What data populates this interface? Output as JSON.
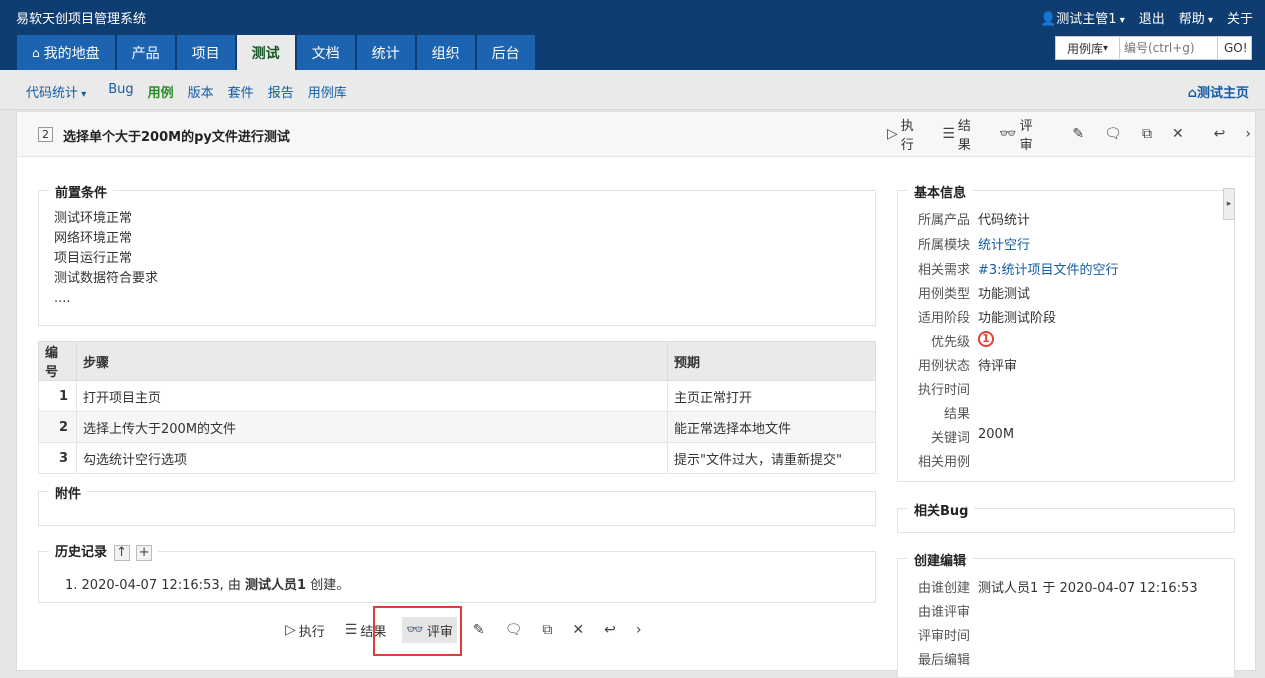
{
  "header": {
    "app_title": "易软天创项目管理系统",
    "user": "测试主管1",
    "logout": "退出",
    "help": "帮助",
    "about": "关于",
    "search_type": "用例库",
    "search_placeholder": "编号(ctrl+g)",
    "search_go": "GO!"
  },
  "main_nav": [
    "我的地盘",
    "产品",
    "项目",
    "测试",
    "文档",
    "统计",
    "组织",
    "后台"
  ],
  "sub_nav": {
    "product": "代码统计",
    "items": [
      "Bug",
      "用例",
      "版本",
      "套件",
      "报告",
      "用例库"
    ],
    "home": "测试主页"
  },
  "case": {
    "id": "2",
    "title": "选择单个大于200M的py文件进行测试"
  },
  "toolbar": {
    "run": "执行",
    "result": "结果",
    "review": "评审"
  },
  "precondition": {
    "title": "前置条件",
    "lines": [
      "测试环境正常",
      "网络环境正常",
      "项目运行正常",
      "测试数据符合要求",
      "...."
    ]
  },
  "steps": {
    "headers": [
      "编号",
      "步骤",
      "预期"
    ],
    "rows": [
      {
        "num": "1",
        "step": "打开项目主页",
        "expect": "主页正常打开"
      },
      {
        "num": "2",
        "step": "选择上传大于200M的文件",
        "expect": "能正常选择本地文件"
      },
      {
        "num": "3",
        "step": "勾选统计空行选项",
        "expect": "提示\"文件过大，请重新提交\""
      }
    ]
  },
  "attachments": {
    "title": "附件"
  },
  "history": {
    "title": "历史记录",
    "entry_prefix": "1. 2020-04-07 12:16:53, 由 ",
    "entry_user": "测试人员1",
    "entry_suffix": " 创建。"
  },
  "basic_info": {
    "title": "基本信息",
    "rows": [
      {
        "label": "所属产品",
        "value": "代码统计"
      },
      {
        "label": "所属模块",
        "value": "统计空行"
      },
      {
        "label": "相关需求",
        "value": "#3:统计项目文件的空行"
      },
      {
        "label": "用例类型",
        "value": "功能测试"
      },
      {
        "label": "适用阶段",
        "value": "功能测试阶段"
      },
      {
        "label": "优先级",
        "value": "1"
      },
      {
        "label": "用例状态",
        "value": "待评审"
      },
      {
        "label": "执行时间",
        "value": ""
      },
      {
        "label": "结果",
        "value": ""
      },
      {
        "label": "关键词",
        "value": "200M"
      },
      {
        "label": "相关用例",
        "value": ""
      }
    ]
  },
  "related_bug": {
    "title": "相关Bug"
  },
  "create_edit": {
    "title": "创建编辑",
    "rows": [
      {
        "label": "由谁创建",
        "value": "测试人员1 于 2020-04-07 12:16:53"
      },
      {
        "label": "由谁评审",
        "value": ""
      },
      {
        "label": "评审时间",
        "value": ""
      },
      {
        "label": "最后编辑",
        "value": ""
      }
    ]
  },
  "colors": {
    "header_bg": "#0f3d71",
    "tab_bg": "#1d64b0",
    "active_green": "#2f8a2f",
    "link_blue": "#145ca5",
    "priority_red": "#e0413a",
    "highlight_red": "#e03a3a"
  }
}
